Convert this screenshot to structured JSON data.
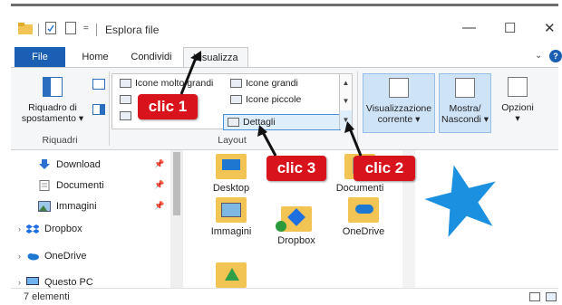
{
  "window": {
    "title": "Esplora file",
    "controls": {
      "minimize": "—",
      "maximize": "☐",
      "close": "✕"
    }
  },
  "tabs": {
    "file": "File",
    "home": "Home",
    "share": "Condividi",
    "view": "Visualizza"
  },
  "ribbon": {
    "panes": {
      "navigation_pane_line1": "Riquadro di",
      "navigation_pane_line2": "spostamento ▾",
      "group_label": "Riquadri"
    },
    "layout": {
      "items": {
        "very_large_icons": "Icone molto grandi",
        "large_icons": "Icone grandi",
        "small_icons": "Icone piccole",
        "details": "Dettagli"
      },
      "group_label": "Layout"
    },
    "current_view_line1": "Visualizzazione",
    "current_view_line2": "corrente ▾",
    "show_hide_line1": "Mostra/",
    "show_hide_line2": "Nascondi ▾",
    "options_line1": "Opzioni",
    "options_line2": "▾"
  },
  "navigation": {
    "items": [
      {
        "label": "Download"
      },
      {
        "label": "Documenti"
      },
      {
        "label": "Immagini"
      },
      {
        "label": "Dropbox"
      },
      {
        "label": "OneDrive"
      },
      {
        "label": "Questo PC"
      }
    ]
  },
  "files": {
    "items": [
      {
        "label": "Desktop"
      },
      {
        "label": "Documenti"
      },
      {
        "label": "Immagini"
      },
      {
        "label": "Dropbox"
      },
      {
        "label": "OneDrive"
      }
    ]
  },
  "status": {
    "count": "7 elementi"
  },
  "callouts": {
    "clic1": "clic 1",
    "clic2": "clic 2",
    "clic3": "clic 3"
  },
  "colors": {
    "file_tab": "#1a5fb4",
    "callout": "#d9131b",
    "folder": "#f1c453",
    "star": "#1b8fe0"
  }
}
